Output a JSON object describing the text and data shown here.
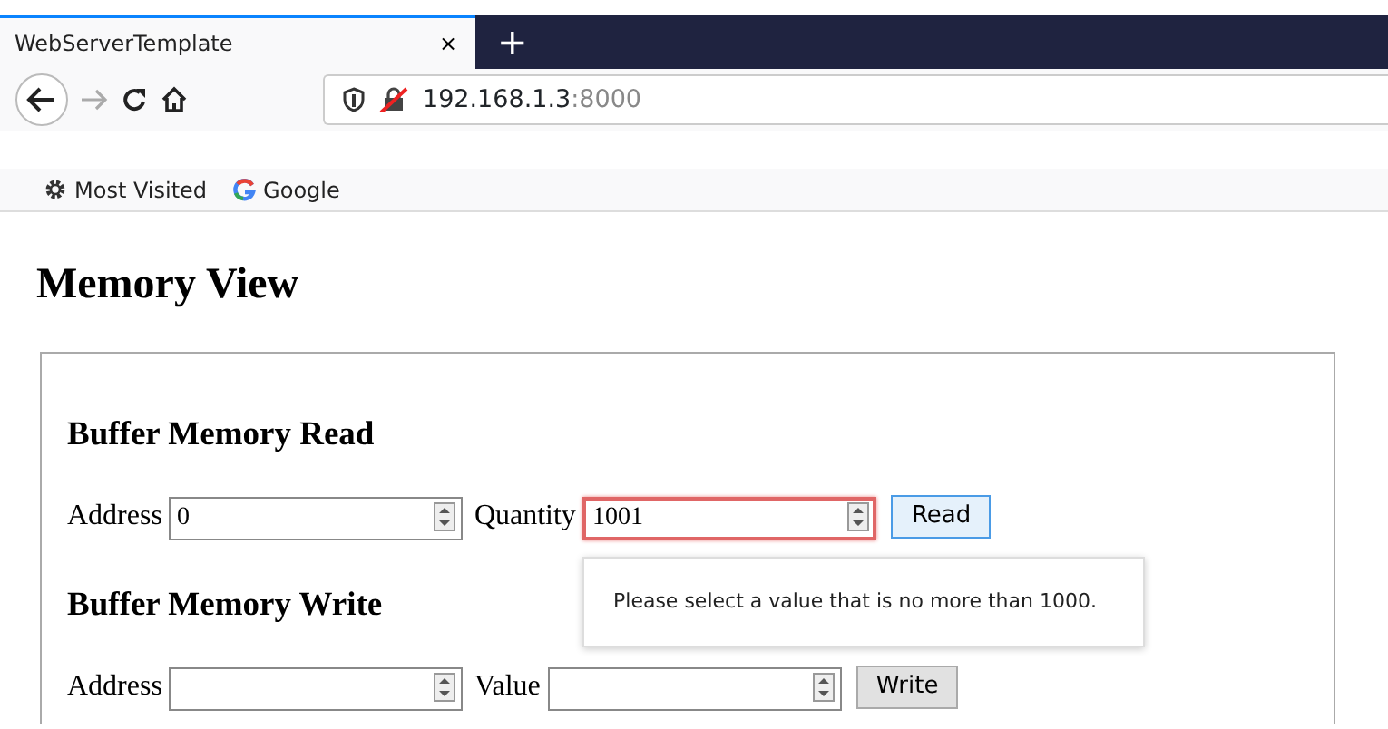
{
  "browser": {
    "tab": {
      "title": "WebServerTemplate",
      "close": "×"
    },
    "new_tab": "+",
    "url": {
      "host": "192.168.1.3",
      "port": ":8000"
    },
    "bookmarks": [
      {
        "label": "Most Visited",
        "kind": "gear"
      },
      {
        "label": "Google",
        "kind": "google"
      }
    ]
  },
  "page": {
    "title": "Memory View",
    "sections": [
      {
        "title": "Buffer Memory Read",
        "fields": [
          {
            "label": "Address",
            "value": "0",
            "invalid": false
          },
          {
            "label": "Quantity",
            "value": "1001",
            "invalid": true
          }
        ],
        "button": {
          "label": "Read",
          "focused": true
        }
      },
      {
        "title": "Buffer Memory Write",
        "fields": [
          {
            "label": "Address",
            "invalid": false
          },
          {
            "label": "Value",
            "invalid": false
          }
        ],
        "button": {
          "label": "Write",
          "focused": false
        }
      }
    ],
    "tooltip": "Please select a value that is no more than 1000."
  }
}
